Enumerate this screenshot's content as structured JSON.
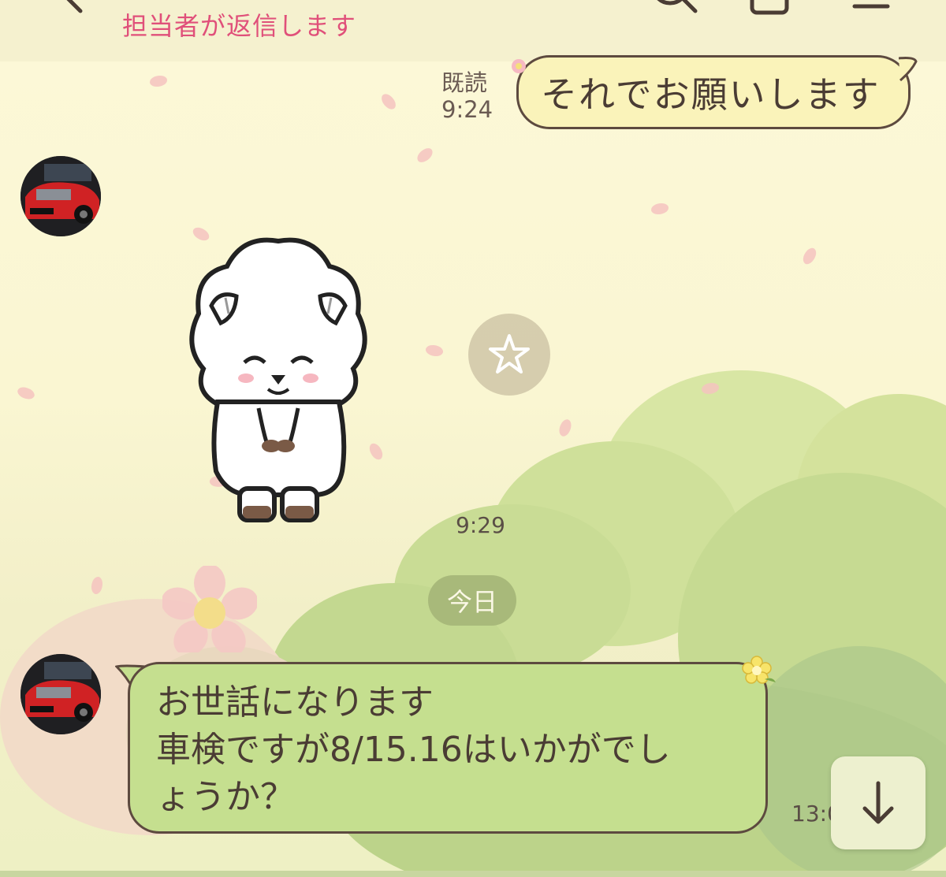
{
  "header": {
    "subtitle": "担当者が返信します",
    "icons": [
      "back-icon",
      "search-icon",
      "calendar-icon",
      "menu-icon"
    ]
  },
  "messages": [
    {
      "direction": "outgoing",
      "text": "それでお願いします",
      "read_label": "既読",
      "time": "9:24"
    },
    {
      "direction": "incoming",
      "type": "sticker",
      "sticker": "sheep-bowing-sticker",
      "time": "9:29"
    },
    {
      "direction": "incoming",
      "text": "お世話になります\n車検ですが8/15.16はいかがでし\nょうか？",
      "time": "13:0"
    }
  ],
  "date_divider": "今日",
  "colors": {
    "header_subtitle": "#e0507a",
    "outgoing_bubble": "#faf3ba",
    "incoming_bubble": "#c5df8f",
    "date_badge": "#a8b97a"
  }
}
